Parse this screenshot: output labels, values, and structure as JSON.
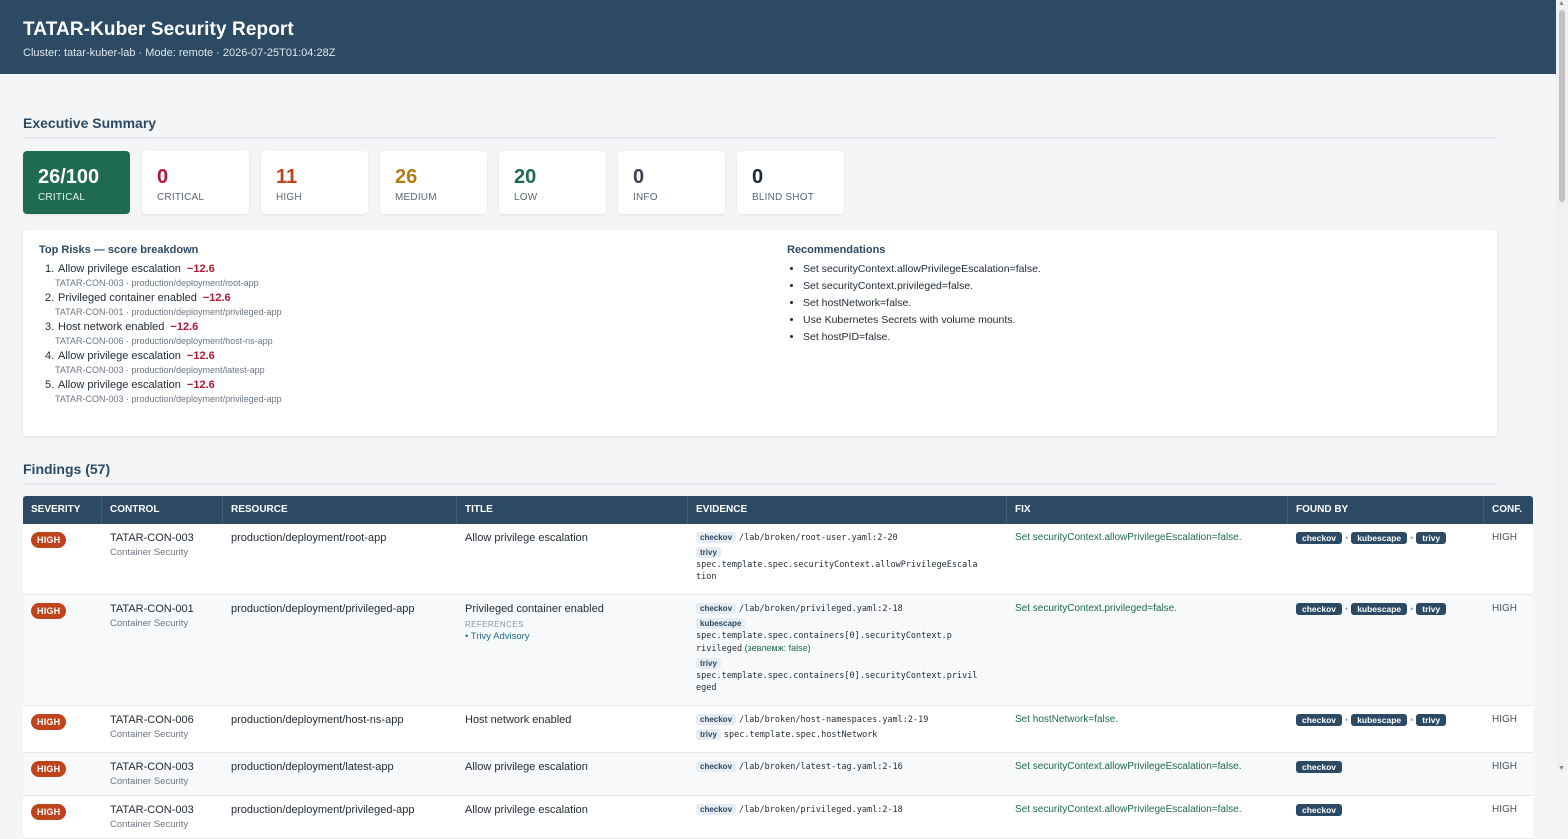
{
  "header": {
    "title": "TATAR-Kuber Security Report",
    "subtitle": "Cluster: tatar-kuber-lab · Mode: remote · 2026-07-25T01:04:28Z"
  },
  "summary": {
    "title": "Executive Summary",
    "score": {
      "value": "26/100",
      "label": "CRITICAL"
    },
    "cards": [
      {
        "value": "0",
        "label": "CRITICAL",
        "color": "#b01838"
      },
      {
        "value": "11",
        "label": "HIGH",
        "color": "#c0431c"
      },
      {
        "value": "26",
        "label": "MEDIUM",
        "color": "#b07d10"
      },
      {
        "value": "20",
        "label": "LOW",
        "color": "#1e6b4f"
      },
      {
        "value": "0",
        "label": "INFO",
        "color": "#3a4450"
      },
      {
        "value": "0",
        "label": "BLIND SHOT",
        "color": "#1f2933"
      }
    ]
  },
  "risks": {
    "title": "Top Risks — score breakdown",
    "items": [
      {
        "rank": "1.",
        "name": "Allow privilege escalation",
        "delta": "−12.6",
        "meta": "TATAR-CON-003 · production/deployment/root-app"
      },
      {
        "rank": "2.",
        "name": "Privileged container enabled",
        "delta": "−12.6",
        "meta": "TATAR-CON-001 · production/deployment/privileged-app"
      },
      {
        "rank": "3.",
        "name": "Host network enabled",
        "delta": "−12.6",
        "meta": "TATAR-CON-006 · production/deployment/host-ns-app"
      },
      {
        "rank": "4.",
        "name": "Allow privilege escalation",
        "delta": "−12.6",
        "meta": "TATAR-CON-003 · production/deployment/latest-app"
      },
      {
        "rank": "5.",
        "name": "Allow privilege escalation",
        "delta": "−12.6",
        "meta": "TATAR-CON-003 · production/deployment/privileged-app"
      }
    ]
  },
  "recommendations": {
    "title": "Recommendations",
    "items": [
      "Set securityContext.allowPrivilegeEscalation=false.",
      "Set securityContext.privileged=false.",
      "Set hostNetwork=false.",
      "Use Kubernetes Secrets with volume mounts.",
      "Set hostPID=false."
    ]
  },
  "findings": {
    "title": "Findings (57)",
    "columns": [
      "SEVERITY",
      "CONTROL",
      "RESOURCE",
      "TITLE",
      "EVIDENCE",
      "FIX",
      "FOUND BY",
      "CONF."
    ],
    "rows": [
      {
        "severity": "HIGH",
        "control": "TATAR-CON-003",
        "category": "Container Security",
        "resource": "production/deployment/root-app",
        "title": "Allow privilege escalation",
        "evidence": [
          {
            "tool": "checkov",
            "text": "/lab/broken/root-user.yaml:2-20"
          },
          {
            "tool": "trivy",
            "text": "spec.template.spec.securityContext.allowPrivilegeEscala tion"
          }
        ],
        "fix": "Set securityContext.allowPrivilegeEscalation=false.",
        "found_by": [
          "checkov",
          "kubescape",
          "trivy"
        ],
        "conf": "HIGH"
      },
      {
        "severity": "HIGH",
        "control": "TATAR-CON-001",
        "category": "Container Security",
        "resource": "production/deployment/privileged-app",
        "title": "Privileged container enabled",
        "refs_label": "REFERENCES",
        "ref_link": "• Trivy Advisory",
        "evidence": [
          {
            "tool": "checkov",
            "text": "/lab/broken/privileged.yaml:2-18"
          },
          {
            "tool": "kubescape",
            "text": "spec.template.spec.containers[0].securityContext.p rivileged",
            "note": "(зевлемж: false)"
          },
          {
            "tool": "trivy",
            "text": "spec.template.spec.containers[0].securityContext.privil eged"
          }
        ],
        "fix": "Set securityContext.privileged=false.",
        "found_by": [
          "checkov",
          "kubescape",
          "trivy"
        ],
        "conf": "HIGH"
      },
      {
        "severity": "HIGH",
        "control": "TATAR-CON-006",
        "category": "Container Security",
        "resource": "production/deployment/host-ns-app",
        "title": "Host network enabled",
        "evidence": [
          {
            "tool": "checkov",
            "text": "/lab/broken/host-namespaces.yaml:2-19"
          },
          {
            "tool": "trivy",
            "text": "spec.template.spec.hostNetwork"
          }
        ],
        "fix": "Set hostNetwork=false.",
        "found_by": [
          "checkov",
          "kubescape",
          "trivy"
        ],
        "conf": "HIGH"
      },
      {
        "severity": "HIGH",
        "control": "TATAR-CON-003",
        "category": "Container Security",
        "resource": "production/deployment/latest-app",
        "title": "Allow privilege escalation",
        "evidence": [
          {
            "tool": "checkov",
            "text": "/lab/broken/latest-tag.yaml:2-16"
          }
        ],
        "fix": "Set securityContext.allowPrivilegeEscalation=false.",
        "found_by": [
          "checkov"
        ],
        "conf": "HIGH"
      },
      {
        "severity": "HIGH",
        "control": "TATAR-CON-003",
        "category": "Container Security",
        "resource": "production/deployment/privileged-app",
        "title": "Allow privilege escalation",
        "evidence": [
          {
            "tool": "checkov",
            "text": "/lab/broken/privileged.yaml:2-18"
          }
        ],
        "fix": "Set securityContext.allowPrivilegeEscalation=false.",
        "found_by": [
          "checkov"
        ],
        "conf": "HIGH"
      }
    ]
  }
}
